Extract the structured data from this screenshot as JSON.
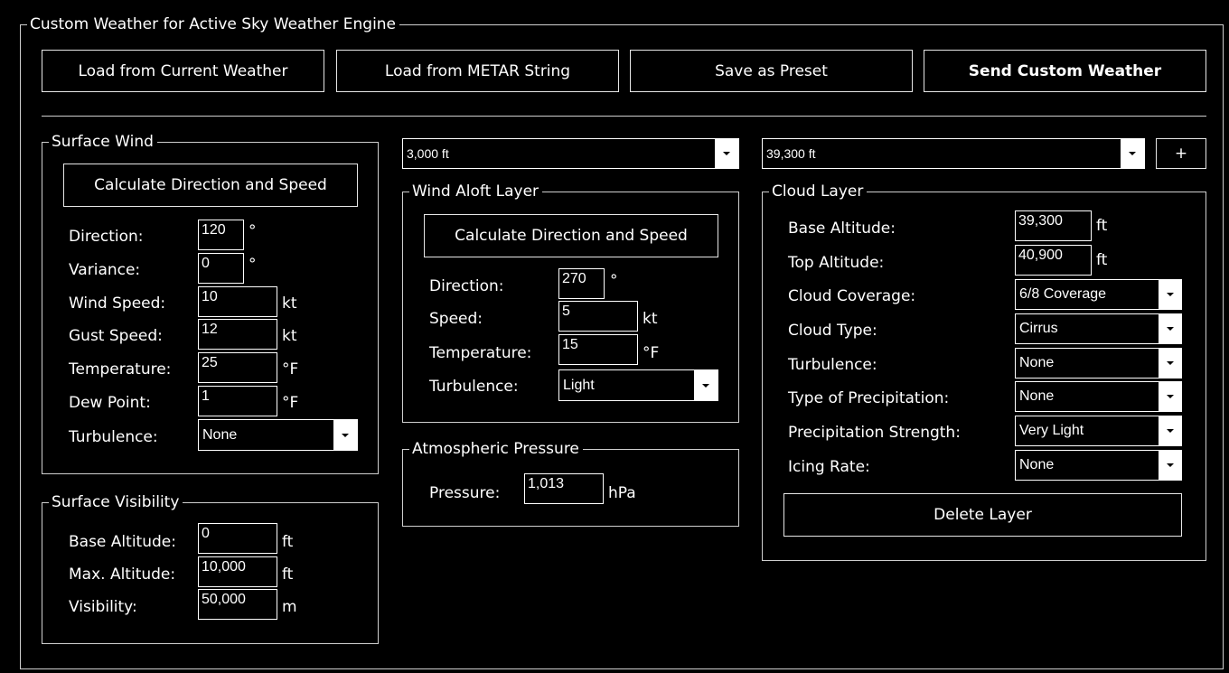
{
  "main": {
    "title": "Custom Weather for Active Sky Weather Engine",
    "buttons": {
      "load_current": "Load from Current Weather",
      "load_metar": "Load from METAR String",
      "save_preset": "Save as Preset",
      "send": "Send Custom Weather"
    }
  },
  "surface_wind": {
    "title": "Surface Wind",
    "calc_button": "Calculate Direction and Speed",
    "direction": {
      "label": "Direction:",
      "value": "120",
      "unit": "°"
    },
    "variance": {
      "label": "Variance:",
      "value": "0",
      "unit": "°"
    },
    "wind_speed": {
      "label": "Wind Speed:",
      "value": "10",
      "unit": "kt"
    },
    "gust_speed": {
      "label": "Gust Speed:",
      "value": "12",
      "unit": "kt"
    },
    "temperature": {
      "label": "Temperature:",
      "value": "25",
      "unit": "°F"
    },
    "dew_point": {
      "label": "Dew Point:",
      "value": "1",
      "unit": "°F"
    },
    "turbulence": {
      "label": "Turbulence:",
      "value": "None"
    }
  },
  "surface_visibility": {
    "title": "Surface Visibility",
    "base_altitude": {
      "label": "Base Altitude:",
      "value": "0",
      "unit": "ft"
    },
    "max_altitude": {
      "label": "Max. Altitude:",
      "value": "10,000",
      "unit": "ft"
    },
    "visibility": {
      "label": "Visibility:",
      "value": "50,000",
      "unit": "m"
    }
  },
  "wind_aloft": {
    "layer_select": "3,000 ft",
    "title": "Wind Aloft Layer",
    "calc_button": "Calculate Direction and Speed",
    "direction": {
      "label": "Direction:",
      "value": "270",
      "unit": "°"
    },
    "speed": {
      "label": "Speed:",
      "value": "5",
      "unit": "kt"
    },
    "temperature": {
      "label": "Temperature:",
      "value": "15",
      "unit": "°F"
    },
    "turbulence": {
      "label": "Turbulence:",
      "value": "Light"
    }
  },
  "pressure": {
    "title": "Atmospheric Pressure",
    "label": "Pressure:",
    "value": "1,013",
    "unit": "hPa"
  },
  "cloud": {
    "layer_select": "39,300 ft",
    "add_button": "+",
    "title": "Cloud Layer",
    "base_altitude": {
      "label": "Base Altitude:",
      "value": "39,300",
      "unit": "ft"
    },
    "top_altitude": {
      "label": "Top Altitude:",
      "value": "40,900",
      "unit": "ft"
    },
    "coverage": {
      "label": "Cloud Coverage:",
      "value": "6/8 Coverage"
    },
    "type": {
      "label": "Cloud Type:",
      "value": "Cirrus"
    },
    "turbulence": {
      "label": "Turbulence:",
      "value": "None"
    },
    "precip_type": {
      "label": "Type of Precipitation:",
      "value": "None"
    },
    "precip_strength": {
      "label": "Precipitation Strength:",
      "value": "Very Light"
    },
    "icing": {
      "label": "Icing Rate:",
      "value": "None"
    },
    "delete_button": "Delete Layer"
  }
}
